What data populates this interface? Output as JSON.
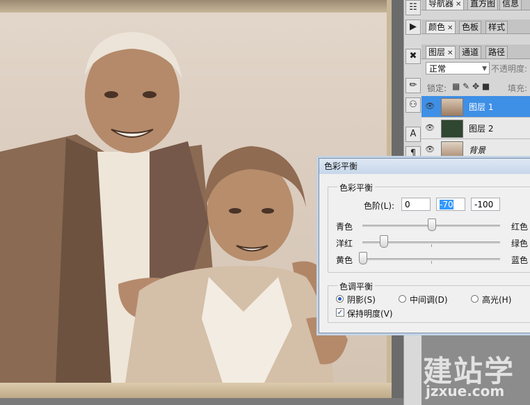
{
  "toolbar_icons": [
    "binoculars-icon",
    "play-icon",
    "tools-icon",
    "brush-icon",
    "stamp-icon",
    "type-icon",
    "paragraph-icon"
  ],
  "panel_tabs_1": [
    {
      "label": "导航器"
    },
    {
      "label": "直方图"
    },
    {
      "label": "信息"
    }
  ],
  "panel_tabs_2": [
    {
      "label": "颜色"
    },
    {
      "label": "色板"
    },
    {
      "label": "样式"
    }
  ],
  "panel_tabs_3": [
    {
      "label": "图层"
    },
    {
      "label": "通道"
    },
    {
      "label": "路径"
    }
  ],
  "layers_panel": {
    "blend_mode": "正常",
    "opacity_label": "不透明度:",
    "lock_label": "锁定:",
    "fill_label": "填充:",
    "layers": [
      {
        "name": "图层 1",
        "selected": true
      },
      {
        "name": "图层 2",
        "selected": false
      },
      {
        "name": "背景",
        "selected": false
      }
    ]
  },
  "dialog": {
    "title": "色彩平衡",
    "color_balance_group": "色彩平衡",
    "levels_label": "色阶(L):",
    "levels": [
      "0",
      "-70",
      "-100"
    ],
    "sliders": [
      {
        "left": "青色",
        "right": "红色",
        "value": 0
      },
      {
        "left": "洋红",
        "right": "绿色",
        "value": -70
      },
      {
        "left": "黄色",
        "right": "蓝色",
        "value": -100
      }
    ],
    "tone_group": "色调平衡",
    "tones": [
      {
        "label": "阴影(S)",
        "checked": true
      },
      {
        "label": "中间调(D)",
        "checked": false
      },
      {
        "label": "高光(H)",
        "checked": false
      }
    ],
    "preserve_label": "保持明度(V)",
    "preserve_checked": true
  },
  "watermark": {
    "cn": "建站学",
    "en": "jzxue.com"
  }
}
